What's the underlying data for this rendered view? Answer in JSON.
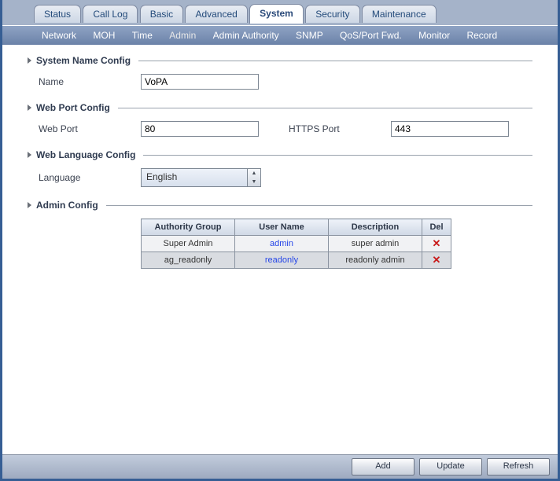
{
  "tabs": [
    "Status",
    "Call Log",
    "Basic",
    "Advanced",
    "System",
    "Security",
    "Maintenance"
  ],
  "active_tab": "System",
  "subnav": [
    "Network",
    "MOH",
    "Time",
    "Admin",
    "Admin Authority",
    "SNMP",
    "QoS/Port Fwd.",
    "Monitor",
    "Record"
  ],
  "active_subnav": "Admin",
  "sections": {
    "sys_name": {
      "title": "System Name Config",
      "name_label": "Name",
      "name_value": "VoPA"
    },
    "web_port": {
      "title": "Web Port Config",
      "web_label": "Web Port",
      "web_value": "80",
      "https_label": "HTTPS Port",
      "https_value": "443"
    },
    "web_lang": {
      "title": "Web Language Config",
      "lang_label": "Language",
      "lang_value": "English"
    },
    "admin_cfg": {
      "title": "Admin Config"
    }
  },
  "admin_table": {
    "headers": {
      "authority": "Authority Group",
      "user": "User Name",
      "desc": "Description",
      "del": "Del"
    },
    "rows": [
      {
        "authority": "Super Admin",
        "user": "admin",
        "desc": "super admin"
      },
      {
        "authority": "ag_readonly",
        "user": "readonly",
        "desc": "readonly admin"
      }
    ]
  },
  "footer": {
    "add": "Add",
    "update": "Update",
    "refresh": "Refresh"
  }
}
